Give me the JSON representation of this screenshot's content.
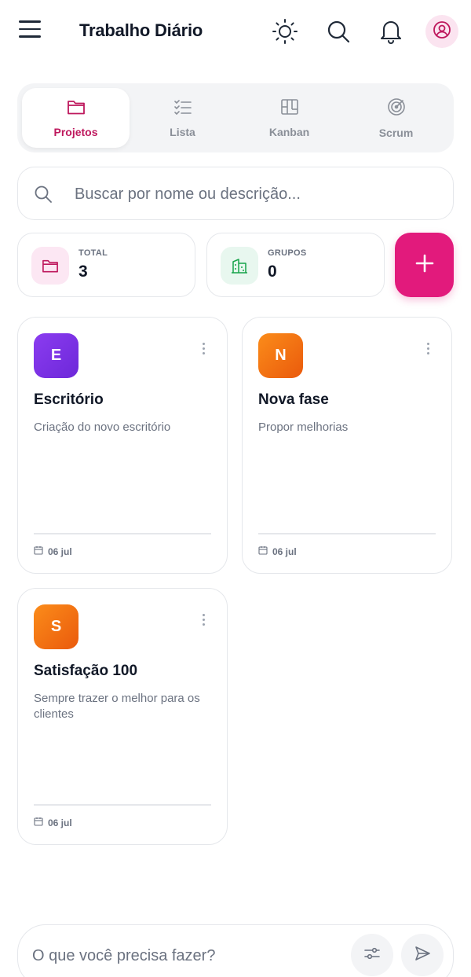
{
  "header": {
    "title": "Trabalho Diário",
    "icons": [
      "menu-icon",
      "sun-icon",
      "search-icon",
      "bell-icon",
      "user-icon"
    ]
  },
  "tabs": [
    {
      "label": "Projetos",
      "icon": "folder-icon",
      "active": true
    },
    {
      "label": "Lista",
      "icon": "checklist-icon",
      "active": false
    },
    {
      "label": "Kanban",
      "icon": "kanban-icon",
      "active": false
    },
    {
      "label": "Scrum",
      "icon": "target-icon",
      "active": false
    }
  ],
  "search": {
    "placeholder": "Buscar por nome ou descrição..."
  },
  "stats": {
    "total": {
      "label": "TOTAL",
      "value": "3"
    },
    "groups": {
      "label": "GRUPOS",
      "value": "0"
    }
  },
  "projects": [
    {
      "initial": "E",
      "title": "Escritório",
      "description": "Criação do novo escritório",
      "date": "06 jul",
      "color": "#7c3aed"
    },
    {
      "initial": "N",
      "title": "Nova fase",
      "description": "Propor melhorias",
      "date": "06 jul",
      "color": "#f97316"
    },
    {
      "initial": "S",
      "title": "Satisfação 100",
      "description": "Sempre trazer o melhor para os clientes",
      "date": "06 jul",
      "color": "#f97316"
    }
  ],
  "composer": {
    "placeholder": "O que você precisa fazer?"
  },
  "colors": {
    "accent": "#e21a7c",
    "active_tab_text": "#be185d"
  }
}
